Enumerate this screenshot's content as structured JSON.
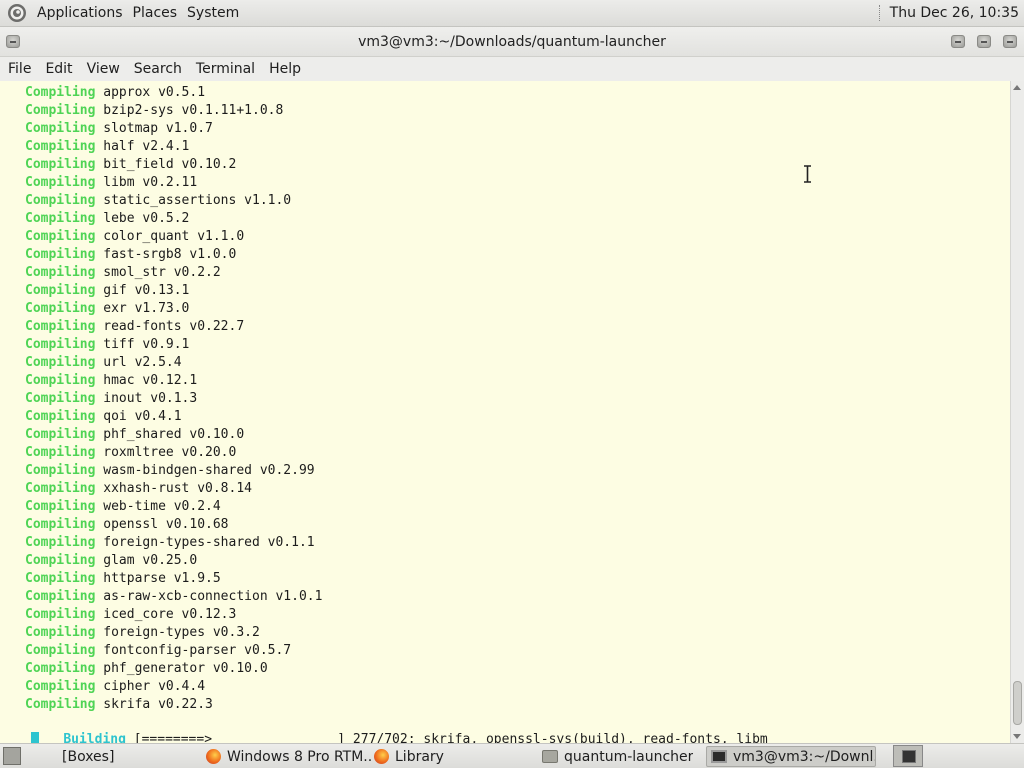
{
  "top_panel": {
    "menus": [
      "Applications",
      "Places",
      "System"
    ],
    "clock": "Thu Dec 26, 10:35"
  },
  "window": {
    "title": "vm3@vm3:~/Downloads/quantum-launcher"
  },
  "menubar": [
    "File",
    "Edit",
    "View",
    "Search",
    "Terminal",
    "Help"
  ],
  "terminal": {
    "keyword": "Compiling",
    "lines": [
      "approx v0.5.1",
      "bzip2-sys v0.1.11+1.0.8",
      "slotmap v1.0.7",
      "half v2.4.1",
      "bit_field v0.10.2",
      "libm v0.2.11",
      "static_assertions v1.1.0",
      "lebe v0.5.2",
      "color_quant v1.1.0",
      "fast-srgb8 v1.0.0",
      "smol_str v0.2.2",
      "gif v0.13.1",
      "exr v1.73.0",
      "read-fonts v0.22.7",
      "tiff v0.9.1",
      "url v2.5.4",
      "hmac v0.12.1",
      "inout v0.1.3",
      "qoi v0.4.1",
      "phf_shared v0.10.0",
      "roxmltree v0.20.0",
      "wasm-bindgen-shared v0.2.99",
      "xxhash-rust v0.8.14",
      "web-time v0.2.4",
      "openssl v0.10.68",
      "foreign-types-shared v0.1.1",
      "glam v0.25.0",
      "httparse v1.9.5",
      "as-raw-xcb-connection v1.0.1",
      "iced_core v0.12.3",
      "foreign-types v0.3.2",
      "fontconfig-parser v0.5.7",
      "phf_generator v0.10.0",
      "cipher v0.4.4",
      "skrifa v0.22.3"
    ],
    "build_keyword": "Building",
    "build_progress_bar": "[========>                ]",
    "build_status": "277/702: skrifa, openssl-sys(build), read-fonts, libm"
  },
  "taskbar": {
    "items": [
      "[Boxes]",
      "Windows 8 Pro RTM...",
      "Library",
      "quantum-launcher",
      "vm3@vm3:~/Downl..."
    ]
  }
}
